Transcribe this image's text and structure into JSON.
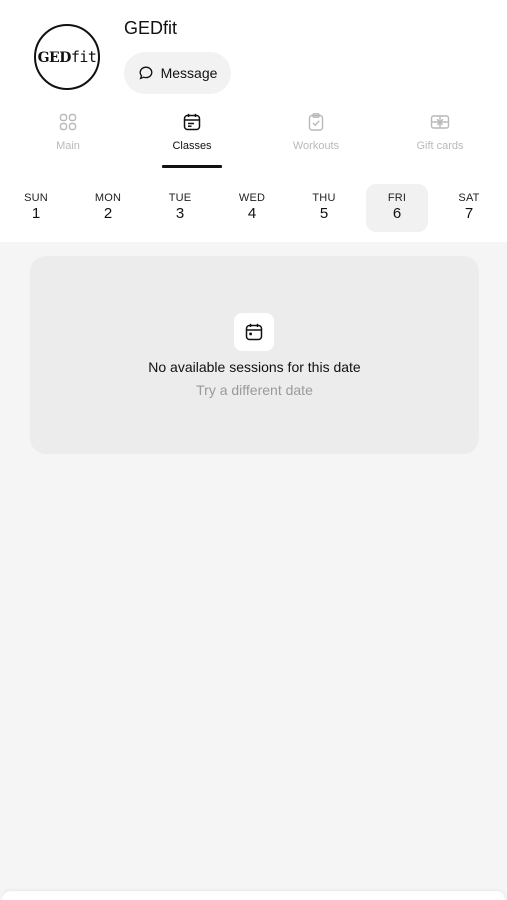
{
  "header": {
    "logo": {
      "bold": "GED",
      "light": "fit"
    },
    "brand_name": "GEDfit",
    "message_button": {
      "label": "Message",
      "icon": "chat-bubble-icon"
    }
  },
  "tabs": [
    {
      "label": "Main",
      "icon": "grid-icon",
      "active": false
    },
    {
      "label": "Classes",
      "icon": "calendar-icon",
      "active": true
    },
    {
      "label": "Workouts",
      "icon": "clipboard-check-icon",
      "active": false
    },
    {
      "label": "Gift cards",
      "icon": "gift-card-icon",
      "active": false
    }
  ],
  "days": [
    {
      "name": "SUN",
      "num": "1",
      "selected": false
    },
    {
      "name": "MON",
      "num": "2",
      "selected": false
    },
    {
      "name": "TUE",
      "num": "3",
      "selected": false
    },
    {
      "name": "WED",
      "num": "4",
      "selected": false
    },
    {
      "name": "THU",
      "num": "5",
      "selected": false
    },
    {
      "name": "FRI",
      "num": "6",
      "selected": true
    },
    {
      "name": "SAT",
      "num": "7",
      "selected": false
    }
  ],
  "empty_state": {
    "icon": "calendar-icon",
    "title": "No available sessions for this date",
    "subtitle": "Try a different date"
  },
  "colors": {
    "active": "#111111",
    "inactive": "#b9b9b9",
    "background": "#f5f5f5",
    "card": "#ececec"
  }
}
